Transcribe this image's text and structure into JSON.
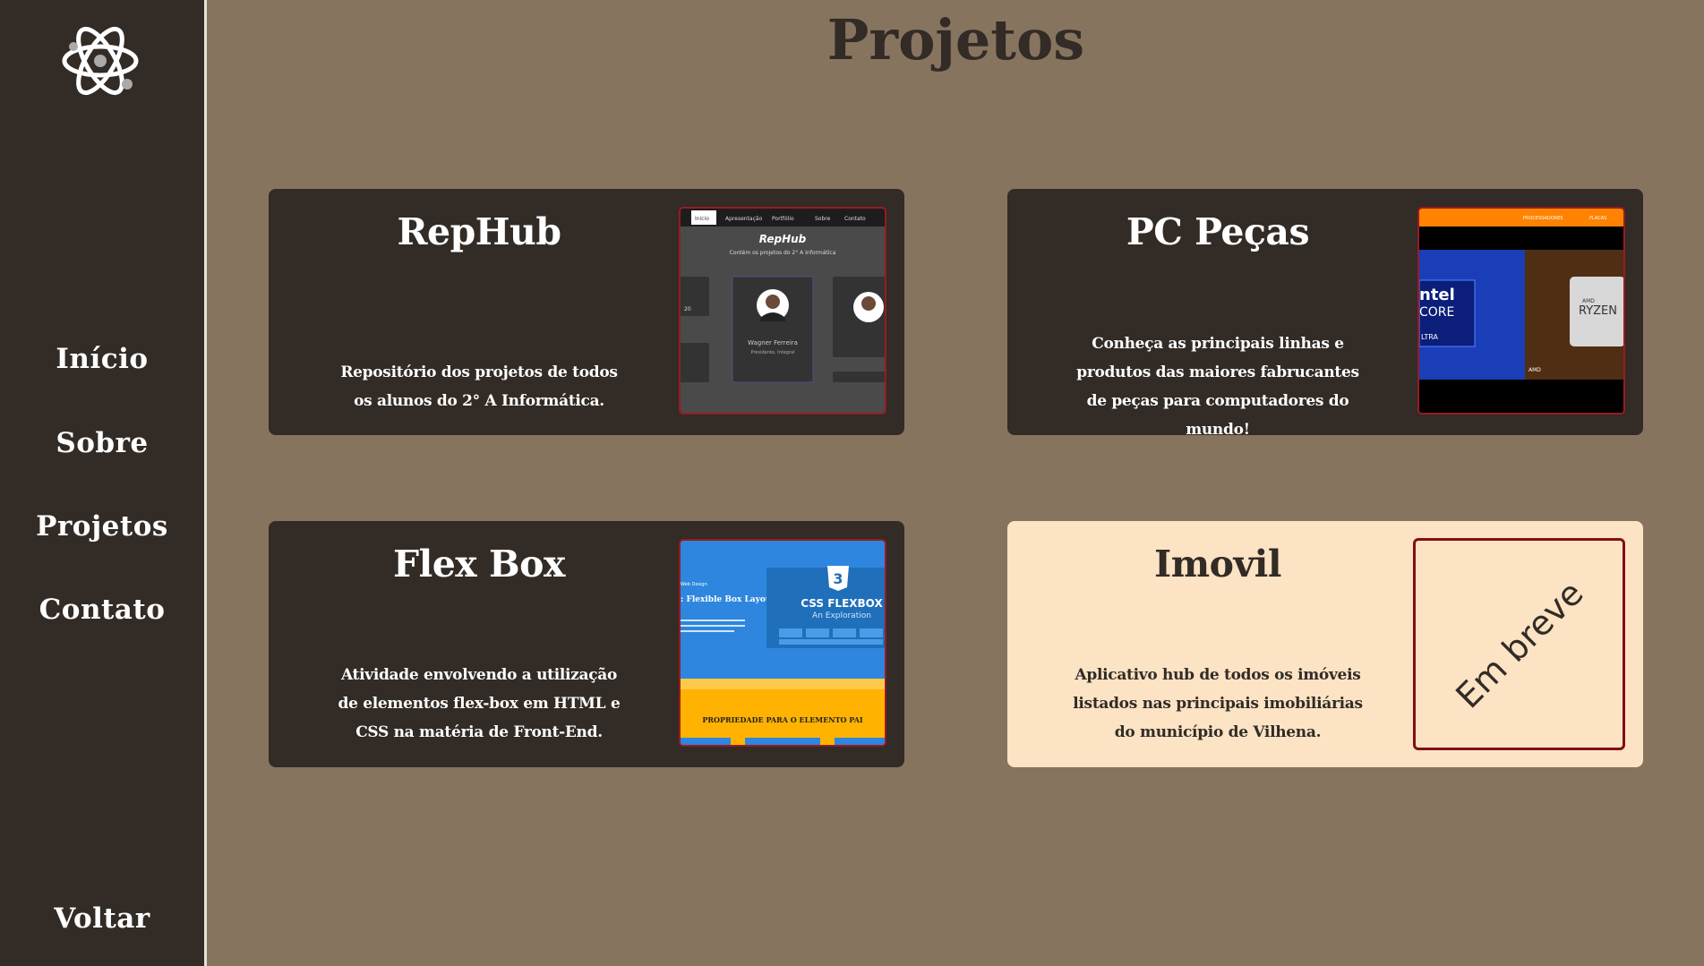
{
  "sidebar": {
    "logo_icon": "atom-icon",
    "nav": [
      {
        "label": "Início"
      },
      {
        "label": "Sobre"
      },
      {
        "label": "Projetos"
      },
      {
        "label": "Contato"
      }
    ],
    "back_label": "Voltar"
  },
  "page": {
    "title": "Projetos"
  },
  "colors": {
    "background": "#87745f",
    "sidebar": "#322b26",
    "card_dark": "#322b26",
    "card_light": "#fbe3c4",
    "accent_border": "#9a1a22"
  },
  "projects": [
    {
      "title": "RepHub",
      "description": "Repositório dos projetos de todos os alunos do 2° A Informática.",
      "thumb": {
        "tabs": [
          "Início",
          "Apresentação",
          "Portfólio",
          "Sobre",
          "Contato"
        ],
        "title": "RepHub",
        "subtitle": "Contém os projetos do 2° A Informática",
        "person": "Wagner Ferreira",
        "person_role": "Presidente, Integral",
        "num": "20"
      }
    },
    {
      "title": "PC Peças",
      "description": "Conheça as principais linhas e produtos das maiores fabrucantes de peças para computadores do mundo!",
      "thumb": {
        "top_links": [
          "PROCESSADORES",
          "PLACAS"
        ],
        "brand1_a": "ntel",
        "brand1_b": "CORE",
        "brand1_c": "LTRA",
        "brand2_a": "AMD",
        "brand2_b": "RYZEN",
        "brand2_c": "AMD"
      }
    },
    {
      "title": "Flex Box",
      "description": "Atividade envolvendo a utilização de elementos flex-box em HTML e CSS na matéria de Front-End.",
      "thumb": {
        "small": "Web Design",
        "heading": ": Flexible Box Layout",
        "badge": "3",
        "css_title": "CSS FLEXBOX",
        "css_sub": "An Exploration",
        "footer": "PROPRIEDADE PARA O ELEMENTO PAI"
      }
    },
    {
      "title": "Imovil",
      "description": "Aplicativo hub de todos os imóveis listados nas principais imobiliárias do município de Vilhena.",
      "soon": "Em breve"
    }
  ]
}
